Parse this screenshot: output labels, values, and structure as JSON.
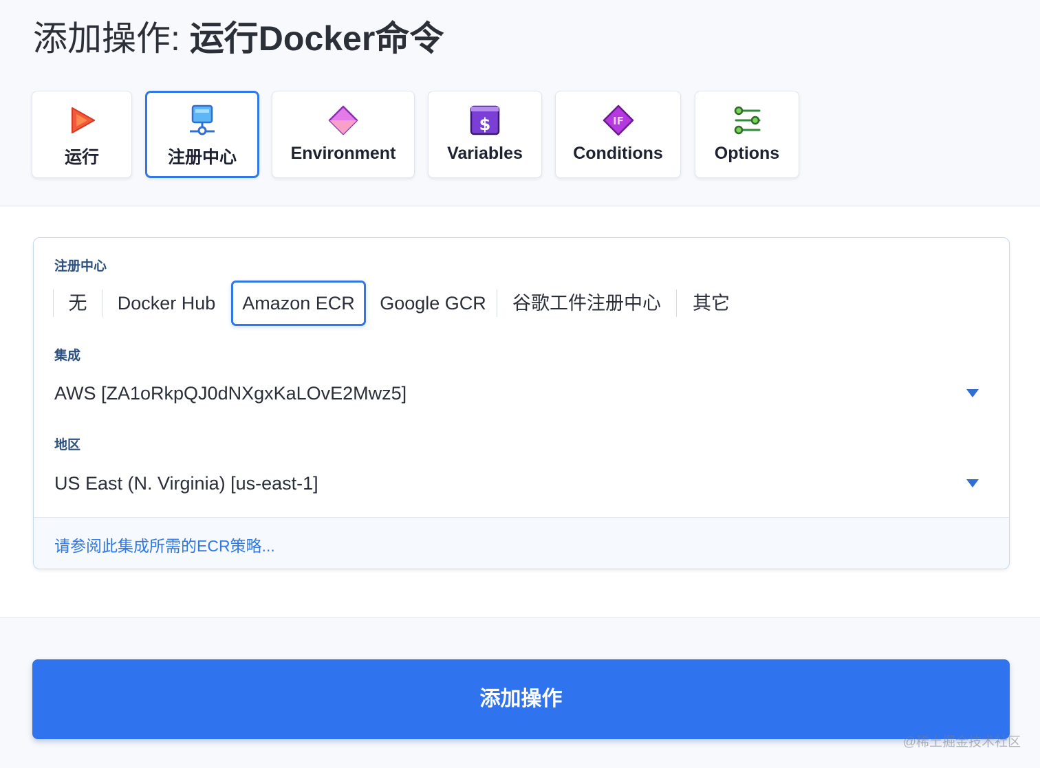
{
  "header": {
    "title_prefix": "添加操作: ",
    "title_action": "运行Docker命令"
  },
  "tabs": [
    {
      "label": "运行",
      "icon": "play-icon"
    },
    {
      "label": "注册中心",
      "icon": "registry-server-icon",
      "active": true
    },
    {
      "label": "Environment",
      "icon": "diamond-icon"
    },
    {
      "label": "Variables",
      "icon": "dollar-box-icon"
    },
    {
      "label": "Conditions",
      "icon": "if-diamond-icon"
    },
    {
      "label": "Options",
      "icon": "sliders-icon"
    }
  ],
  "registry": {
    "label": "注册中心",
    "options": [
      "无",
      "Docker Hub",
      "Amazon ECR",
      "Google GCR",
      "谷歌工件注册中心",
      "其它"
    ],
    "selected": "Amazon ECR"
  },
  "integration": {
    "label": "集成",
    "value": "AWS [ZA1oRkpQJ0dNXgxKaLOvE2Mwz5]"
  },
  "region": {
    "label": "地区",
    "value": "US East (N. Virginia) [us-east-1]"
  },
  "policy_link": "请参阅此集成所需的ECR策略...",
  "submit_label": "添加操作",
  "watermark": "@稀土掘金技术社区",
  "colors": {
    "accent": "#2f78e6",
    "button": "#2f73ee"
  }
}
